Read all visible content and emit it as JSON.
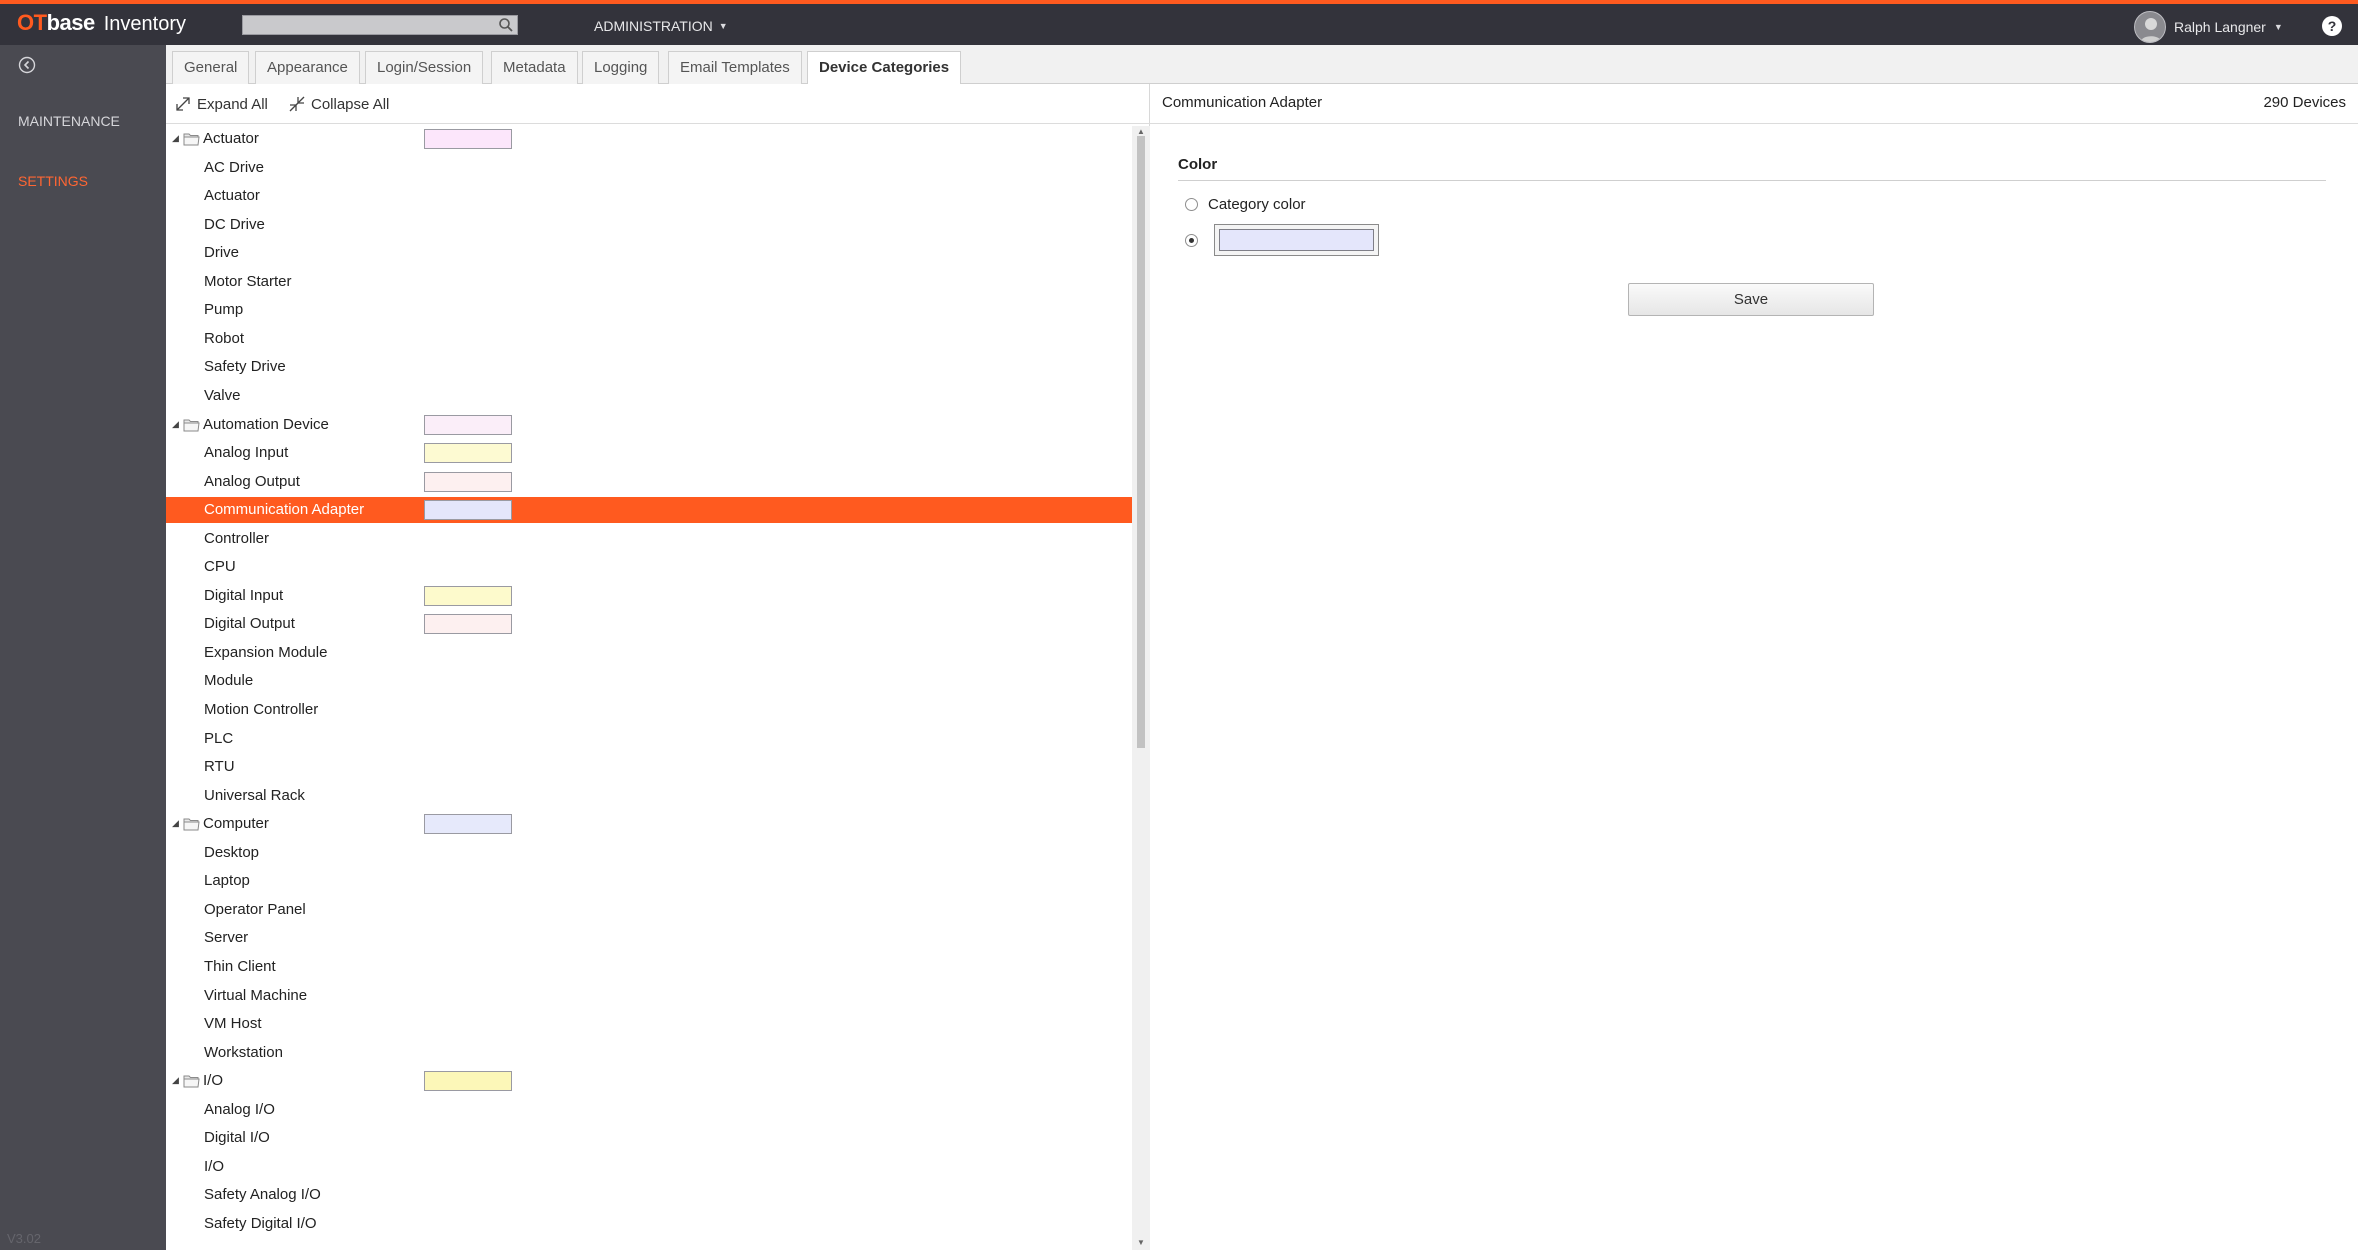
{
  "app": {
    "logo_ot": "OT",
    "logo_base": "base",
    "product": "Inventory",
    "admin_menu": "ADMINISTRATION",
    "user_name": "Ralph Langner",
    "help": "?",
    "accent_color": "#ff5a1f"
  },
  "sidebar": {
    "items": [
      {
        "label": "MAINTENANCE"
      },
      {
        "label": "SETTINGS",
        "active": true
      }
    ],
    "version": "V3.02"
  },
  "tabs": [
    {
      "label": "General"
    },
    {
      "label": "Appearance"
    },
    {
      "label": "Login/Session"
    },
    {
      "label": "Metadata"
    },
    {
      "label": "Logging"
    },
    {
      "label": "Email Templates"
    },
    {
      "label": "Device Categories",
      "active": true
    }
  ],
  "tree_toolbar": {
    "expand_all": "Expand All",
    "collapse_all": "Collapse All"
  },
  "tree": [
    {
      "label": "Actuator",
      "level": 0,
      "color": "#fce6fb"
    },
    {
      "label": "AC Drive",
      "level": 1
    },
    {
      "label": "Actuator",
      "level": 1
    },
    {
      "label": "DC Drive",
      "level": 1
    },
    {
      "label": "Drive",
      "level": 1
    },
    {
      "label": "Motor Starter",
      "level": 1
    },
    {
      "label": "Pump",
      "level": 1
    },
    {
      "label": "Robot",
      "level": 1
    },
    {
      "label": "Safety Drive",
      "level": 1
    },
    {
      "label": "Valve",
      "level": 1
    },
    {
      "label": "Automation Device",
      "level": 0,
      "color": "#fbeef9"
    },
    {
      "label": "Analog Input",
      "level": 1,
      "color": "#fdfad2"
    },
    {
      "label": "Analog Output",
      "level": 1,
      "color": "#fdf0f0"
    },
    {
      "label": "Communication Adapter",
      "level": 1,
      "color": "#e4e6fb",
      "selected": true
    },
    {
      "label": "Controller",
      "level": 1
    },
    {
      "label": "CPU",
      "level": 1
    },
    {
      "label": "Digital Input",
      "level": 1,
      "color": "#fdfacc"
    },
    {
      "label": "Digital Output",
      "level": 1,
      "color": "#fdf0f0"
    },
    {
      "label": "Expansion Module",
      "level": 1
    },
    {
      "label": "Module",
      "level": 1
    },
    {
      "label": "Motion Controller",
      "level": 1
    },
    {
      "label": "PLC",
      "level": 1
    },
    {
      "label": "RTU",
      "level": 1
    },
    {
      "label": "Universal Rack",
      "level": 1
    },
    {
      "label": "Computer",
      "level": 0,
      "color": "#e6e9fb"
    },
    {
      "label": "Desktop",
      "level": 1
    },
    {
      "label": "Laptop",
      "level": 1
    },
    {
      "label": "Operator Panel",
      "level": 1
    },
    {
      "label": "Server",
      "level": 1
    },
    {
      "label": "Thin Client",
      "level": 1
    },
    {
      "label": "Virtual Machine",
      "level": 1
    },
    {
      "label": "VM Host",
      "level": 1
    },
    {
      "label": "Workstation",
      "level": 1
    },
    {
      "label": "I/O",
      "level": 0,
      "color": "#fcf7b8"
    },
    {
      "label": "Analog I/O",
      "level": 1
    },
    {
      "label": "Digital I/O",
      "level": 1
    },
    {
      "label": "I/O",
      "level": 1
    },
    {
      "label": "Safety Analog I/O",
      "level": 1
    },
    {
      "label": "Safety Digital I/O",
      "level": 1
    }
  ],
  "detail": {
    "title": "Communication Adapter",
    "device_count": "290 Devices",
    "section_title": "Color",
    "option_category_color": "Category color",
    "selected_option": "custom",
    "custom_color": "#e4e6fb",
    "save_label": "Save"
  }
}
